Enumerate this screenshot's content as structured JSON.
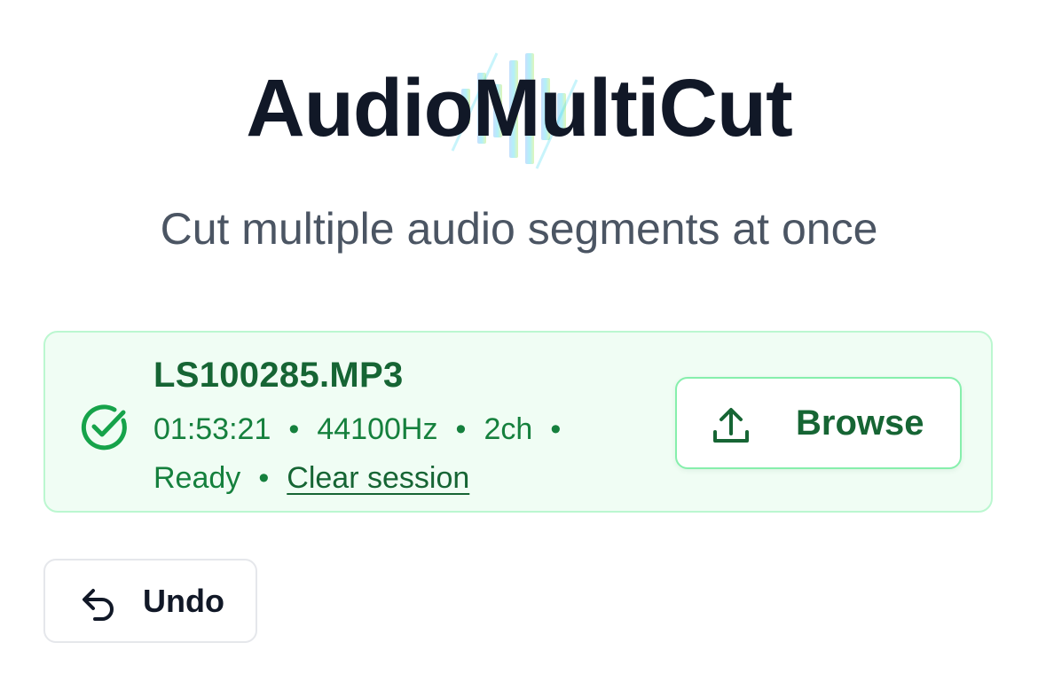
{
  "header": {
    "title": "AudioMultiCut",
    "subtitle": "Cut multiple audio segments at once",
    "waveform_icon": "waveform-icon"
  },
  "file": {
    "name": "LS100285.MP3",
    "duration": "01:53:21",
    "sample_rate": "44100Hz",
    "channels": "2ch",
    "status": "Ready",
    "clear_label": "Clear session",
    "separator": "•",
    "status_icon": "check-circle-icon"
  },
  "browse_button": {
    "label": "Browse",
    "icon": "upload-icon"
  },
  "undo_button": {
    "label": "Undo",
    "icon": "undo-arrow-icon"
  },
  "colors": {
    "title": "#111827",
    "subtitle": "#4b5563",
    "success_text": "#15803d",
    "success_dark": "#166534",
    "card_bg": "#f0fdf4",
    "card_border": "#bbf7d0",
    "button_border": "#86efac"
  }
}
